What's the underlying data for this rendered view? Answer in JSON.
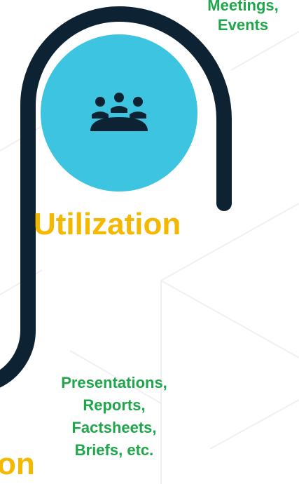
{
  "colors": {
    "pipe": "#0d2233",
    "circle": "#3cc4e0",
    "green_text": "#1fa64a",
    "yellow_text": "#f5b800",
    "icon": "#0d2233"
  },
  "stage": {
    "icon": "meeting-people-icon",
    "top_label_lines": [
      "Meetings,",
      "Events"
    ],
    "title": "Utilization"
  },
  "lower_stage": {
    "label_lines": [
      "Presentations,",
      "Reports,",
      "Factsheets,",
      "Briefs, etc."
    ],
    "title_fragment": "on"
  }
}
